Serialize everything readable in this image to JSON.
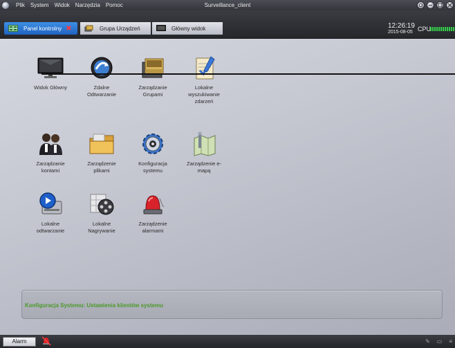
{
  "window": {
    "title": "Surveillance_client"
  },
  "menu": [
    "Plik",
    "System",
    "Widok",
    "Narzędzia",
    "Pomoc"
  ],
  "tabs": [
    {
      "label": "Panel kontrolny",
      "icon": "control-panel-icon",
      "active": true
    },
    {
      "label": "Grupa Urządzeń",
      "icon": "device-group-icon",
      "active": false
    },
    {
      "label": "Główny widok",
      "icon": "monitor-icon",
      "active": false
    }
  ],
  "status": {
    "time": "12:26:19",
    "date": "2015-08-05",
    "cpu_label": "CPU"
  },
  "items": {
    "widok_glowny": {
      "line1": "Widok Główny",
      "line2": "",
      "line3": "",
      "icon": "monitor-icon"
    },
    "zdalne_odtwarzanie": {
      "line1": "Zdalne",
      "line2": "Odtwarzanie",
      "line3": "",
      "icon": "remote-playback-icon"
    },
    "zarzadzanie_grupami": {
      "line1": "Zarządzanie",
      "line2": "Grupami",
      "line3": "",
      "icon": "group-management-icon"
    },
    "lokalne_wyszukiwanie": {
      "line1": "Lokalne",
      "line2": "wyszukiwanie",
      "line3": "zdarzeń",
      "icon": "event-search-icon"
    },
    "zarzadzanie_kontami": {
      "line1": "Zarządzanie",
      "line2": "kontami",
      "line3": "",
      "icon": "accounts-icon"
    },
    "zarzadzenie_plikami": {
      "line1": "Zarządzenie",
      "line2": "plikami",
      "line3": "",
      "icon": "folder-icon"
    },
    "konfiguracja_systemu": {
      "line1": "Konfiguracja",
      "line2": "systemu",
      "line3": "",
      "icon": "gear-icon"
    },
    "zarzadzenie_emapa": {
      "line1": "Zarządzenie e-",
      "line2": "mapą",
      "line3": "",
      "icon": "emap-icon"
    },
    "lokalne_odtwarzanie": {
      "line1": "Lokalne",
      "line2": "odtwarzanie",
      "line3": "",
      "icon": "local-playback-icon"
    },
    "lokalne_nagrywanie": {
      "line1": "Lokalne",
      "line2": "Nagrywanie",
      "line3": "",
      "icon": "film-reel-icon"
    },
    "zarzadzenie_alarmami": {
      "line1": "Zarządzenie",
      "line2": "alarmami",
      "line3": "",
      "icon": "alarm-siren-icon"
    }
  },
  "info": {
    "text": "Konfiguracja Systemu: Ustawienia klientów systemu"
  },
  "statusbar": {
    "alarm_label": "Alarm"
  },
  "colors": {
    "active_tab": "#1f62c0",
    "info_text": "#4b9a2a",
    "cpu_meter": "#34d14a",
    "tab_close": "#ff3b3b"
  }
}
